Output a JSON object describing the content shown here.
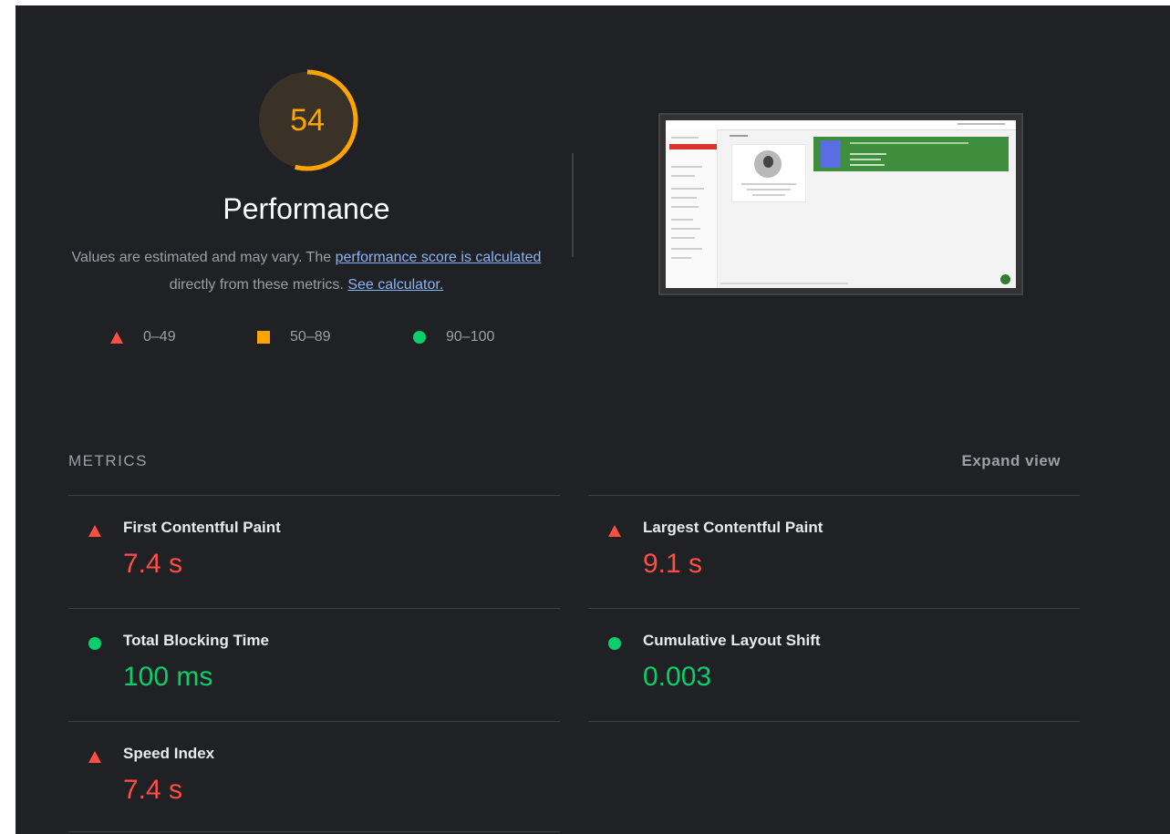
{
  "score": {
    "value": "54",
    "fraction": 0.54,
    "color": "#ffa400",
    "track_color": "#3a3226"
  },
  "category_title": "Performance",
  "description": {
    "text_before": "Values are estimated and may vary. The ",
    "link1": "performance score is calculated",
    "text_middle": " directly from these metrics. ",
    "link2": "See calculator."
  },
  "legend": [
    {
      "range": "0–49",
      "icon": "fail-triangle-icon",
      "color": "#ff4e42"
    },
    {
      "range": "50–89",
      "icon": "average-square-icon",
      "color": "#ffa400"
    },
    {
      "range": "90–100",
      "icon": "pass-circle-icon",
      "color": "#0cce6b"
    }
  ],
  "metrics_section": {
    "header": "METRICS",
    "expand_label": "Expand view"
  },
  "metrics": [
    {
      "title": "First Contentful Paint",
      "value": "7.4 s",
      "status": "fail"
    },
    {
      "title": "Largest Contentful Paint",
      "value": "9.1 s",
      "status": "fail"
    },
    {
      "title": "Total Blocking Time",
      "value": "100 ms",
      "status": "pass"
    },
    {
      "title": "Cumulative Layout Shift",
      "value": "0.003",
      "status": "pass"
    },
    {
      "title": "Speed Index",
      "value": "7.4 s",
      "status": "fail"
    }
  ]
}
